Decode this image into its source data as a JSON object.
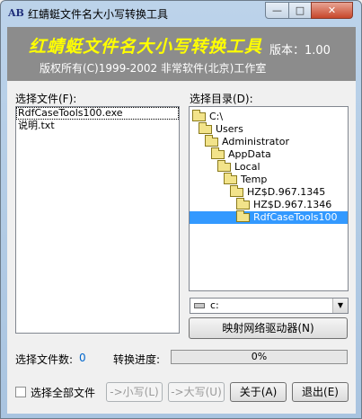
{
  "window": {
    "title": "红蜻蜓文件名大小写转换工具",
    "min_glyph": "—",
    "max_glyph": "□",
    "close_glyph": "✕"
  },
  "banner": {
    "title": "红蜻蜓文件名大小写转换工具",
    "version": "版本：1.00",
    "copyright": "版权所有(C)1999-2002 非常软件(北京)工作室"
  },
  "files": {
    "label": "选择文件(F):",
    "items": [
      "RdfCaseTools100.exe",
      "说明.txt"
    ]
  },
  "directory": {
    "label": "选择目录(D):",
    "tree": [
      "C:\\",
      "Users",
      "Administrator",
      "AppData",
      "Local",
      "Temp",
      "HZ$D.967.1345",
      "HZ$D.967.1346",
      "RdfCaseTools100"
    ],
    "selected_index": 8
  },
  "drive": {
    "value": "c:"
  },
  "buttons": {
    "map_network": "映射网络驱动器(N)",
    "to_lower": "->小写(L)",
    "to_upper": "->大写(U)",
    "about": "关于(A)",
    "exit": "退出(E)"
  },
  "status": {
    "file_count_label": "选择文件数:",
    "file_count": "0",
    "progress_label": "转换进度:",
    "progress": "0%"
  },
  "select_all": {
    "label": "选择全部文件",
    "checked": false
  }
}
